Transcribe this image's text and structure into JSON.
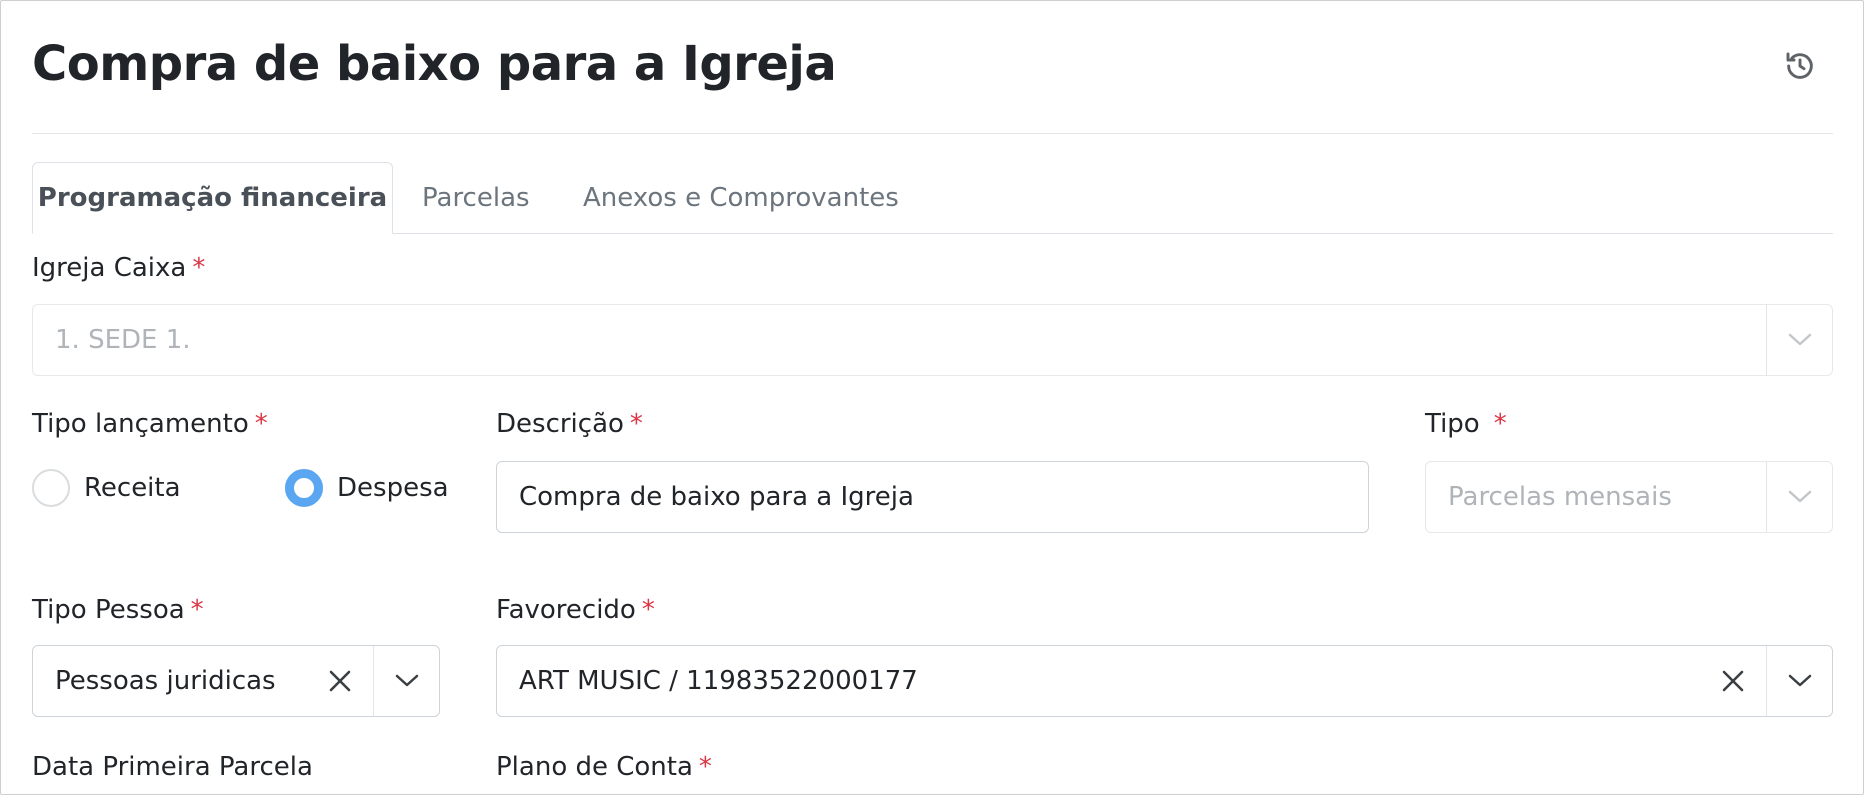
{
  "page": {
    "title": "Compra de baixo para a Igreja"
  },
  "icons": {
    "history": "history-icon",
    "chevron": "chevron-down-icon",
    "clear": "close-icon"
  },
  "tabs": [
    {
      "label": "Programação financeira",
      "active": true
    },
    {
      "label": "Parcelas",
      "active": false
    },
    {
      "label": "Anexos e Comprovantes",
      "active": false
    }
  ],
  "form": {
    "igreja_caixa": {
      "label": "Igreja Caixa",
      "required_mark": "*",
      "value": "1. SEDE 1."
    },
    "tipo_lancamento": {
      "label": "Tipo lançamento",
      "required_mark": "*",
      "options": [
        {
          "label": "Receita",
          "checked": false
        },
        {
          "label": "Despesa",
          "checked": true
        }
      ]
    },
    "descricao": {
      "label": "Descrição",
      "required_mark": "*",
      "value": "Compra de baixo para a Igreja"
    },
    "tipo": {
      "label": "Tipo",
      "required_mark": "*",
      "value": "Parcelas mensais"
    },
    "tipo_pessoa": {
      "label": "Tipo Pessoa",
      "required_mark": "*",
      "value": "Pessoas juridicas"
    },
    "favorecido": {
      "label": "Favorecido",
      "required_mark": "*",
      "value": "ART MUSIC / 11983522000177"
    },
    "data_primeira_parcela": {
      "label": "Data Primeira Parcela"
    },
    "plano_de_conta": {
      "label": "Plano de Conta",
      "required_mark": "*"
    }
  },
  "colors": {
    "required": "#dc3545",
    "radio_checked": "#5aa6f0",
    "text": "#212529",
    "muted": "#6c757d"
  }
}
